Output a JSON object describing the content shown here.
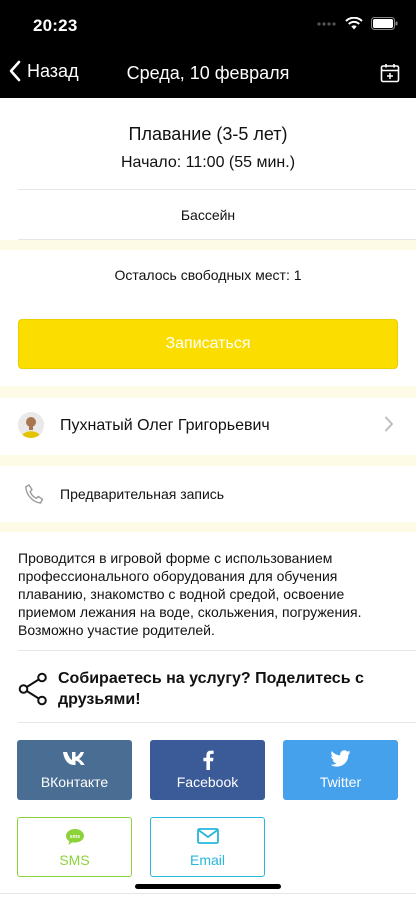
{
  "status_bar": {
    "time": "20:23"
  },
  "nav": {
    "back_label": "Назад",
    "title": "Среда, 10 февраля"
  },
  "event": {
    "title": "Плавание (3-5 лет)",
    "start": "Начало: 11:00 (55 мин.)",
    "location": "Бассейн",
    "seats": "Осталось свободных мест: 1",
    "signup_label": "Записаться"
  },
  "trainer": {
    "name": "Пухнатый Олег Григорьевич"
  },
  "booking": {
    "label": "Предварительная запись"
  },
  "description": "Проводится в игровой форме с использованием профессионального оборудования для обучения плаванию, знакомство с водной средой, освоение приемом лежания на воде, скольжения, погружения. Возможно участие родителей.",
  "share": {
    "prompt": "Собираетесь на услугу? Поделитесь с друзьями!",
    "buttons": {
      "vk": "ВКонтакте",
      "facebook": "Facebook",
      "twitter": "Twitter",
      "sms": "SMS",
      "email": "Email"
    },
    "sms_icon_text": "sms"
  },
  "colors": {
    "accent": "#fbdd00",
    "vk": "#4a6d93",
    "facebook": "#3b5a98",
    "twitter": "#46a1ec",
    "sms": "#8cd33a",
    "email": "#27b6dc"
  }
}
